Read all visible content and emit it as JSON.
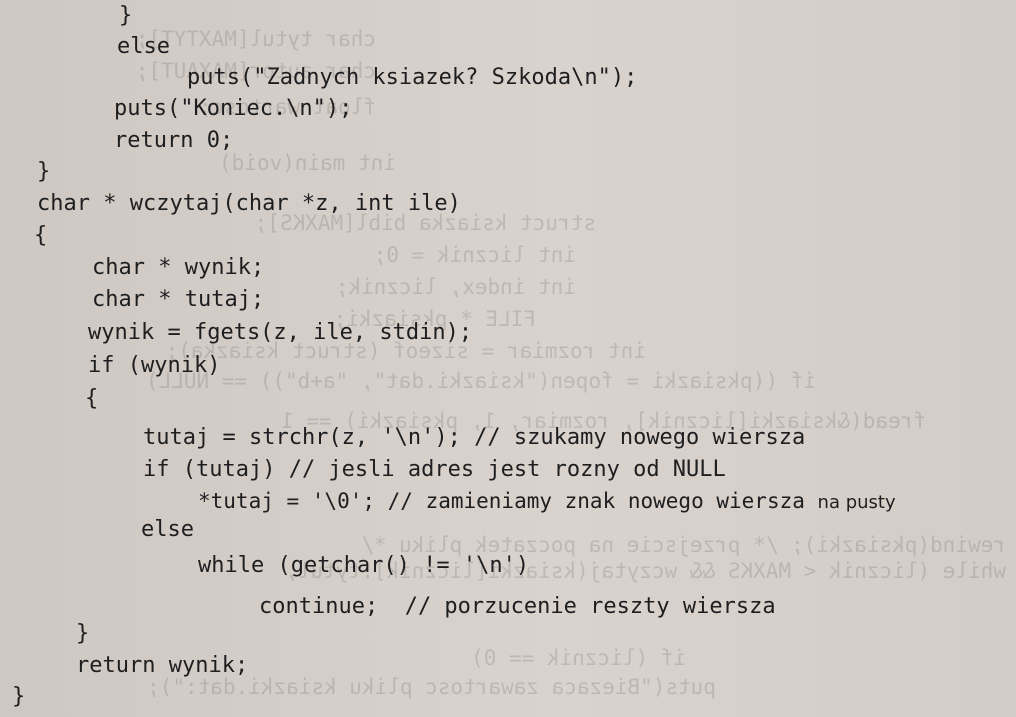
{
  "code_lines": [
    "}",
    "else",
    "puts(\"Zadnych ksiazek? Szkoda\\n\");",
    "puts(\"Koniec.\\n\");",
    "return 0;",
    "}",
    "char * wczytaj(char *z, int ile)",
    "{",
    "char * wynik;",
    "char * tutaj;",
    "wynik = fgets(z, ile, stdin);",
    "if (wynik)",
    "{",
    "tutaj = strchr(z, '\\n'); // szukamy nowego wiersza",
    "if (tutaj) // jesli adres jest rozny od NULL",
    "*tutaj = '\\0'; // zamieniamy znak nowego wiersza",
    "else",
    "while (getchar() != '\\n')",
    "continue;  // porzucenie reszty wiersza",
    "}",
    "return wynik;",
    "}"
  ],
  "line_tail": "na pusty",
  "ghost_lines": [
    "puts(\"Biezaca zawartosc pliku ksiazki.dat:\");",
    "if (licznik == 0)",
    "while (licznik < MAXKS && wczytaj(ksiazki[licznik].tytul,",
    "rewind(pksiazki); /* przejscie na poczatek pliku */",
    "fread(&ksiazki[licznik], rozmiar, 1, pksiazki) == 1",
    "if ((pksiazki = fopen(\"ksiazki.dat\", \"a+b\")) == NULL)",
    "int rozmiar = sizeof (struct ksiazka);",
    "FILE * pksiazki;",
    "int index, licznik;",
    "int licznik = 0;",
    "struct ksiazka bibl[MAXKS];",
    "int main(void)",
    "float wartosc;",
    "char autor[MAXAUT];",
    "char tytul[MAXTYT];"
  ]
}
